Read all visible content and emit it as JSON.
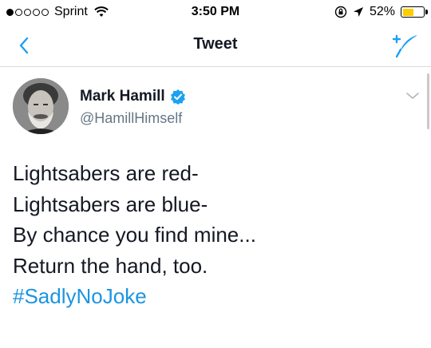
{
  "status_bar": {
    "carrier": "Sprint",
    "signal_bars_filled": 1,
    "signal_bars_total": 5,
    "time": "3:50 PM",
    "battery_percent": "52%",
    "battery_level": 0.52,
    "battery_color": "#ffcc00",
    "icons": [
      "wifi-icon",
      "orientation-lock-icon",
      "location-arrow-icon",
      "battery-icon"
    ]
  },
  "navbar": {
    "title": "Tweet",
    "back_icon": "chevron-left-icon",
    "compose_icon": "compose-tweet-icon",
    "accent": "#1da1f2"
  },
  "tweet": {
    "author_name": "Mark Hamill",
    "verified": true,
    "verified_color": "#1da1f2",
    "author_handle": "@HamillHimself",
    "lines": [
      "Lightsabers are red-",
      "Lightsabers are blue-",
      "By chance you find mine...",
      "Return the hand, too."
    ],
    "hashtag": "#SadlyNoJoke",
    "hashtag_color": "#1b95e0"
  }
}
